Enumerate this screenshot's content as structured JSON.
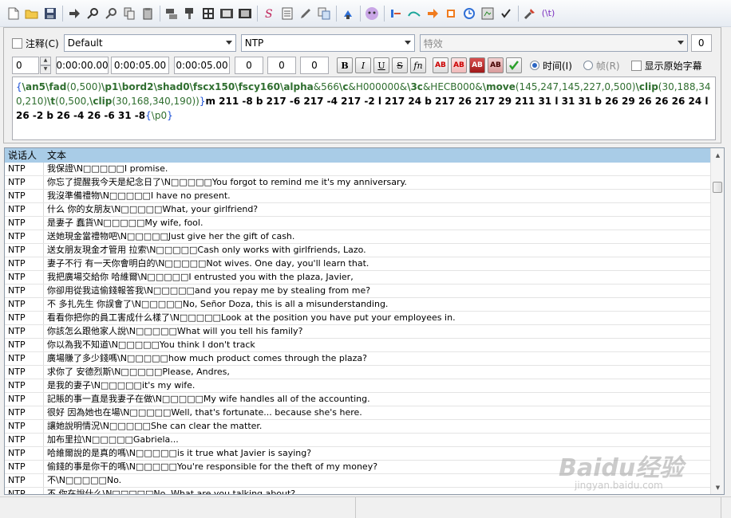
{
  "toolbar": {
    "icons": [
      "new-file",
      "open-folder",
      "save",
      "arrow-right",
      "find",
      "find-replace",
      "copy-style",
      "paste-style",
      "styles-manager",
      "attachments",
      "fonts-collector",
      "video",
      "spell-check",
      "translate",
      "properties",
      "select-tool",
      "timing-tool",
      "ring",
      "kanji-timer",
      "shift",
      "stop",
      "clock",
      "resample",
      "check",
      "tools"
    ],
    "label_t": "(\\t)"
  },
  "editor": {
    "comment_label": "注释(C)",
    "style_value": "Default",
    "actor_value": "NTP",
    "effect_placeholder": "特效",
    "layer_value": "0",
    "margin_value": "0",
    "start_time": "0:00:00.00",
    "end_time": "0:00:05.00",
    "duration": "0:00:05.00",
    "margin_l": "0",
    "margin_r": "0",
    "margin_v": "0",
    "bold_label": "B",
    "italic_label": "I",
    "underline_label": "U",
    "strike_label": "S",
    "fn_label": "fn",
    "color_labels": [
      "AB",
      "AB",
      "AB",
      "AB"
    ],
    "radio_time_label": "时间(I)",
    "radio_frame_label": "帧(R)",
    "show_original_label": "显示原始字幕",
    "text_segments": [
      {
        "t": "{",
        "c": "br"
      },
      {
        "t": "\\an5",
        "c": "tagb"
      },
      {
        "t": "\\fad",
        "c": "tagb"
      },
      {
        "t": "(0,500)",
        "c": "tag"
      },
      {
        "t": "\\p1",
        "c": "tagb"
      },
      {
        "t": "\\bord2",
        "c": "tagb"
      },
      {
        "t": "\\shad0",
        "c": "tagb"
      },
      {
        "t": "\\fscx150",
        "c": "tagb"
      },
      {
        "t": "\\fscy160",
        "c": "tagb"
      },
      {
        "t": "\\alpha",
        "c": "tagb"
      },
      {
        "t": "&566",
        "c": "tag"
      },
      {
        "t": "\\c",
        "c": "tagb"
      },
      {
        "t": "&H000000&",
        "c": "tag"
      },
      {
        "t": "\\3c",
        "c": "tagb"
      },
      {
        "t": "&HECB000&",
        "c": "tag"
      },
      {
        "t": "\\move",
        "c": "tagb"
      },
      {
        "t": "(145,247,145,227,0,500)",
        "c": "tag"
      },
      {
        "t": "\\clip",
        "c": "tagb"
      },
      {
        "t": "(30,188,340,210)",
        "c": "tag"
      },
      {
        "t": "\\t",
        "c": "tagb"
      },
      {
        "t": "(0,500,",
        "c": "tag"
      },
      {
        "t": "\\clip",
        "c": "tagb"
      },
      {
        "t": "(30,168,340,190))",
        "c": "tag"
      },
      {
        "t": "}",
        "c": "br"
      },
      {
        "t": "m 211 -8 b 217 -6 217 -4 217 -2 l 217 24 b 217 26 217 29 211 31 l 31 31 b 26 29 26 26 26 24 l 26 -2 b 26 -4 26 -6 31 -8",
        "c": "txt"
      },
      {
        "t": "{",
        "c": "br"
      },
      {
        "t": "\\p0",
        "c": "tag"
      },
      {
        "t": "}",
        "c": "br"
      }
    ]
  },
  "grid": {
    "headers": [
      "说话人",
      "文本"
    ],
    "rows": [
      [
        "NTP",
        "我保證\\N□□□□□I promise."
      ],
      [
        "NTP",
        "你忘了提醒我今天是紀念日了\\N□□□□□You forgot to remind me it's my anniversary."
      ],
      [
        "NTP",
        "我沒準備禮物\\N□□□□□I have no present."
      ],
      [
        "NTP",
        "什么  你的女朋友\\N□□□□□What, your girlfriend?"
      ],
      [
        "NTP",
        "是妻子  蠢貨\\N□□□□□My wife, fool."
      ],
      [
        "NTP",
        "送她現金當禮物吧\\N□□□□□Just give her the gift of cash."
      ],
      [
        "NTP",
        "送女朋友現金才管用  拉索\\N□□□□□Cash only works with girlfriends, Lazo."
      ],
      [
        "NTP",
        "妻子不行  有一天你會明白的\\N□□□□□Not wives. One day, you'll learn that."
      ],
      [
        "NTP",
        "我把廣場交給你  哈維爾\\N□□□□□I entrusted you with the plaza, Javier,"
      ],
      [
        "NTP",
        "你卻用從我這偷錢報答我\\N□□□□□and you repay me by stealing from me?"
      ],
      [
        "NTP",
        "不  多扎先生  你誤會了\\N□□□□□No, Señor Doza, this is all a misunderstanding."
      ],
      [
        "NTP",
        "看看你把你的員工害成什么樣了\\N□□□□□Look at the position you have put your employees in."
      ],
      [
        "NTP",
        "你該怎么跟他家人說\\N□□□□□What will you tell his family?"
      ],
      [
        "NTP",
        "你以為我不知道\\N□□□□□You think I don't track"
      ],
      [
        "NTP",
        "廣場賺了多少錢嗎\\N□□□□□how much product comes through the plaza?"
      ],
      [
        "NTP",
        "求你了  安德烈斯\\N□□□□□Please, Andres,"
      ],
      [
        "NTP",
        "是我的妻子\\N□□□□□it's my wife."
      ],
      [
        "NTP",
        "記賬的事一直是我妻子在做\\N□□□□□My wife handles all of the accounting."
      ],
      [
        "NTP",
        "很好  因為她也在場\\N□□□□□Well, that's fortunate... because she's here."
      ],
      [
        "NTP",
        "讓她說明情況\\N□□□□□She can clear the matter."
      ],
      [
        "NTP",
        "加布里拉\\N□□□□□Gabriela..."
      ],
      [
        "NTP",
        "哈維爾說的是真的嗎\\N□□□□□is it true what Javier is saying?"
      ],
      [
        "NTP",
        "偷錢的事是你干的嗎\\N□□□□□You're responsible for the theft of my money?"
      ],
      [
        "NTP",
        "不\\N□□□□□No."
      ],
      [
        "NTP",
        "不  你在說什么\\N□□□□□No. What are you talking about?"
      ]
    ]
  },
  "watermark": {
    "brand": "Baidu经验",
    "url": "jingyan.baidu.com"
  }
}
